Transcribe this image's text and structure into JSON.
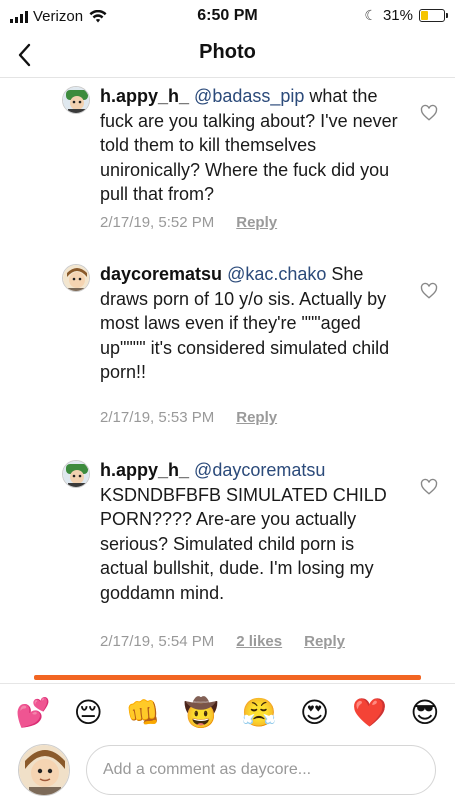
{
  "status_bar": {
    "carrier": "Verizon",
    "time": "6:50 PM",
    "battery": "31%",
    "battery_level": 0.31,
    "battery_color": "#f5c400"
  },
  "nav": {
    "back_icon": "chevron-left-icon",
    "title": "Photo"
  },
  "comments": [
    {
      "username": "h.appy_h_",
      "mention": "@badass_pip",
      "text": " what the fuck are you talking about? I've never told them to kill themselves unironically? Where the fuck did you pull that from?",
      "timestamp": "2/17/19, 5:52 PM",
      "likes": "",
      "reply": "Reply"
    },
    {
      "username": "daycorematsu",
      "mention": "@kac.chako",
      "text": " She draws porn of 10 y/o sis. Actually by most laws even if they're \"\"\"aged up\"\"\"\" it's considered simulated child porn!!",
      "timestamp": "2/17/19, 5:53 PM",
      "likes": "",
      "reply": "Reply"
    },
    {
      "username": "h.appy_h_",
      "mention": "@daycorematsu",
      "text": " KSDNDBFBFB SIMULATED CHILD PORN???? Are-are you actually serious? Simulated child porn is actual bullshit, dude. I'm losing my goddamn mind.",
      "timestamp": "2/17/19, 5:54 PM",
      "likes": "2 likes",
      "reply": "Reply"
    }
  ],
  "progress": {
    "fraction": 0.85,
    "color": "#f26522"
  },
  "emoji_bar": [
    "💕",
    "😔",
    "👊",
    "🤠",
    "😤",
    "😍",
    "❤️",
    "😎"
  ],
  "composer": {
    "placeholder": "Add a comment as daycore..."
  }
}
